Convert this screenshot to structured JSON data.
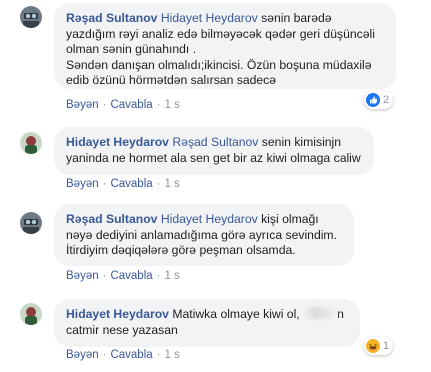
{
  "comments": [
    {
      "author": "Rəşad Sultanov",
      "mention": "Hidayet Heydarov",
      "text": " sənin barədə yazdığım rəyi analiz edə bilməyəcək qədər geri düşüncəli olman sənin günahındı .",
      "text2": "Səndən danışan olmalıdı;ikincisi. Özün boşuna müdaxilə edib özünü hörmətdən salırsan sadecə",
      "like": "Bəyən",
      "reply": "Cavabla",
      "time": "1 s",
      "reaction_count": "2",
      "reaction_icon": "like-icon"
    },
    {
      "author": "Hidayet Heydarov",
      "mention": "Rəşad Sultanov",
      "text": " senin kimisinjn yaninda ne hormet ala sen get bir az kiwi olmaga caliw",
      "like": "Bəyən",
      "reply": "Cavabla",
      "time": "1 s"
    },
    {
      "author": "Rəşad Sultanov",
      "mention": "Hidayet Heydarov",
      "text": " kişi olmağı nəyə dediyini anlamadığıma görə ayrıca sevindim.",
      "text2": "İtirdiyim dəqiqələrə görə peşman olsamda.",
      "like": "Bəyən",
      "reply": "Cavabla",
      "time": "1 s"
    },
    {
      "author": "Hidayet Heydarov",
      "text_a": " Matiwka olmaye kiwi ol,",
      "text_b": "n catmir nese yazasan",
      "like": "Bəyən",
      "reply": "Cavabla",
      "time": "1 s",
      "reaction_count": "1",
      "reaction_icon": "haha-icon"
    }
  ],
  "colors": {
    "link": "#385898",
    "bubble": "#f2f3f5",
    "meta": "#90949c",
    "like": "#1877f2",
    "haha": "#f7b125"
  }
}
